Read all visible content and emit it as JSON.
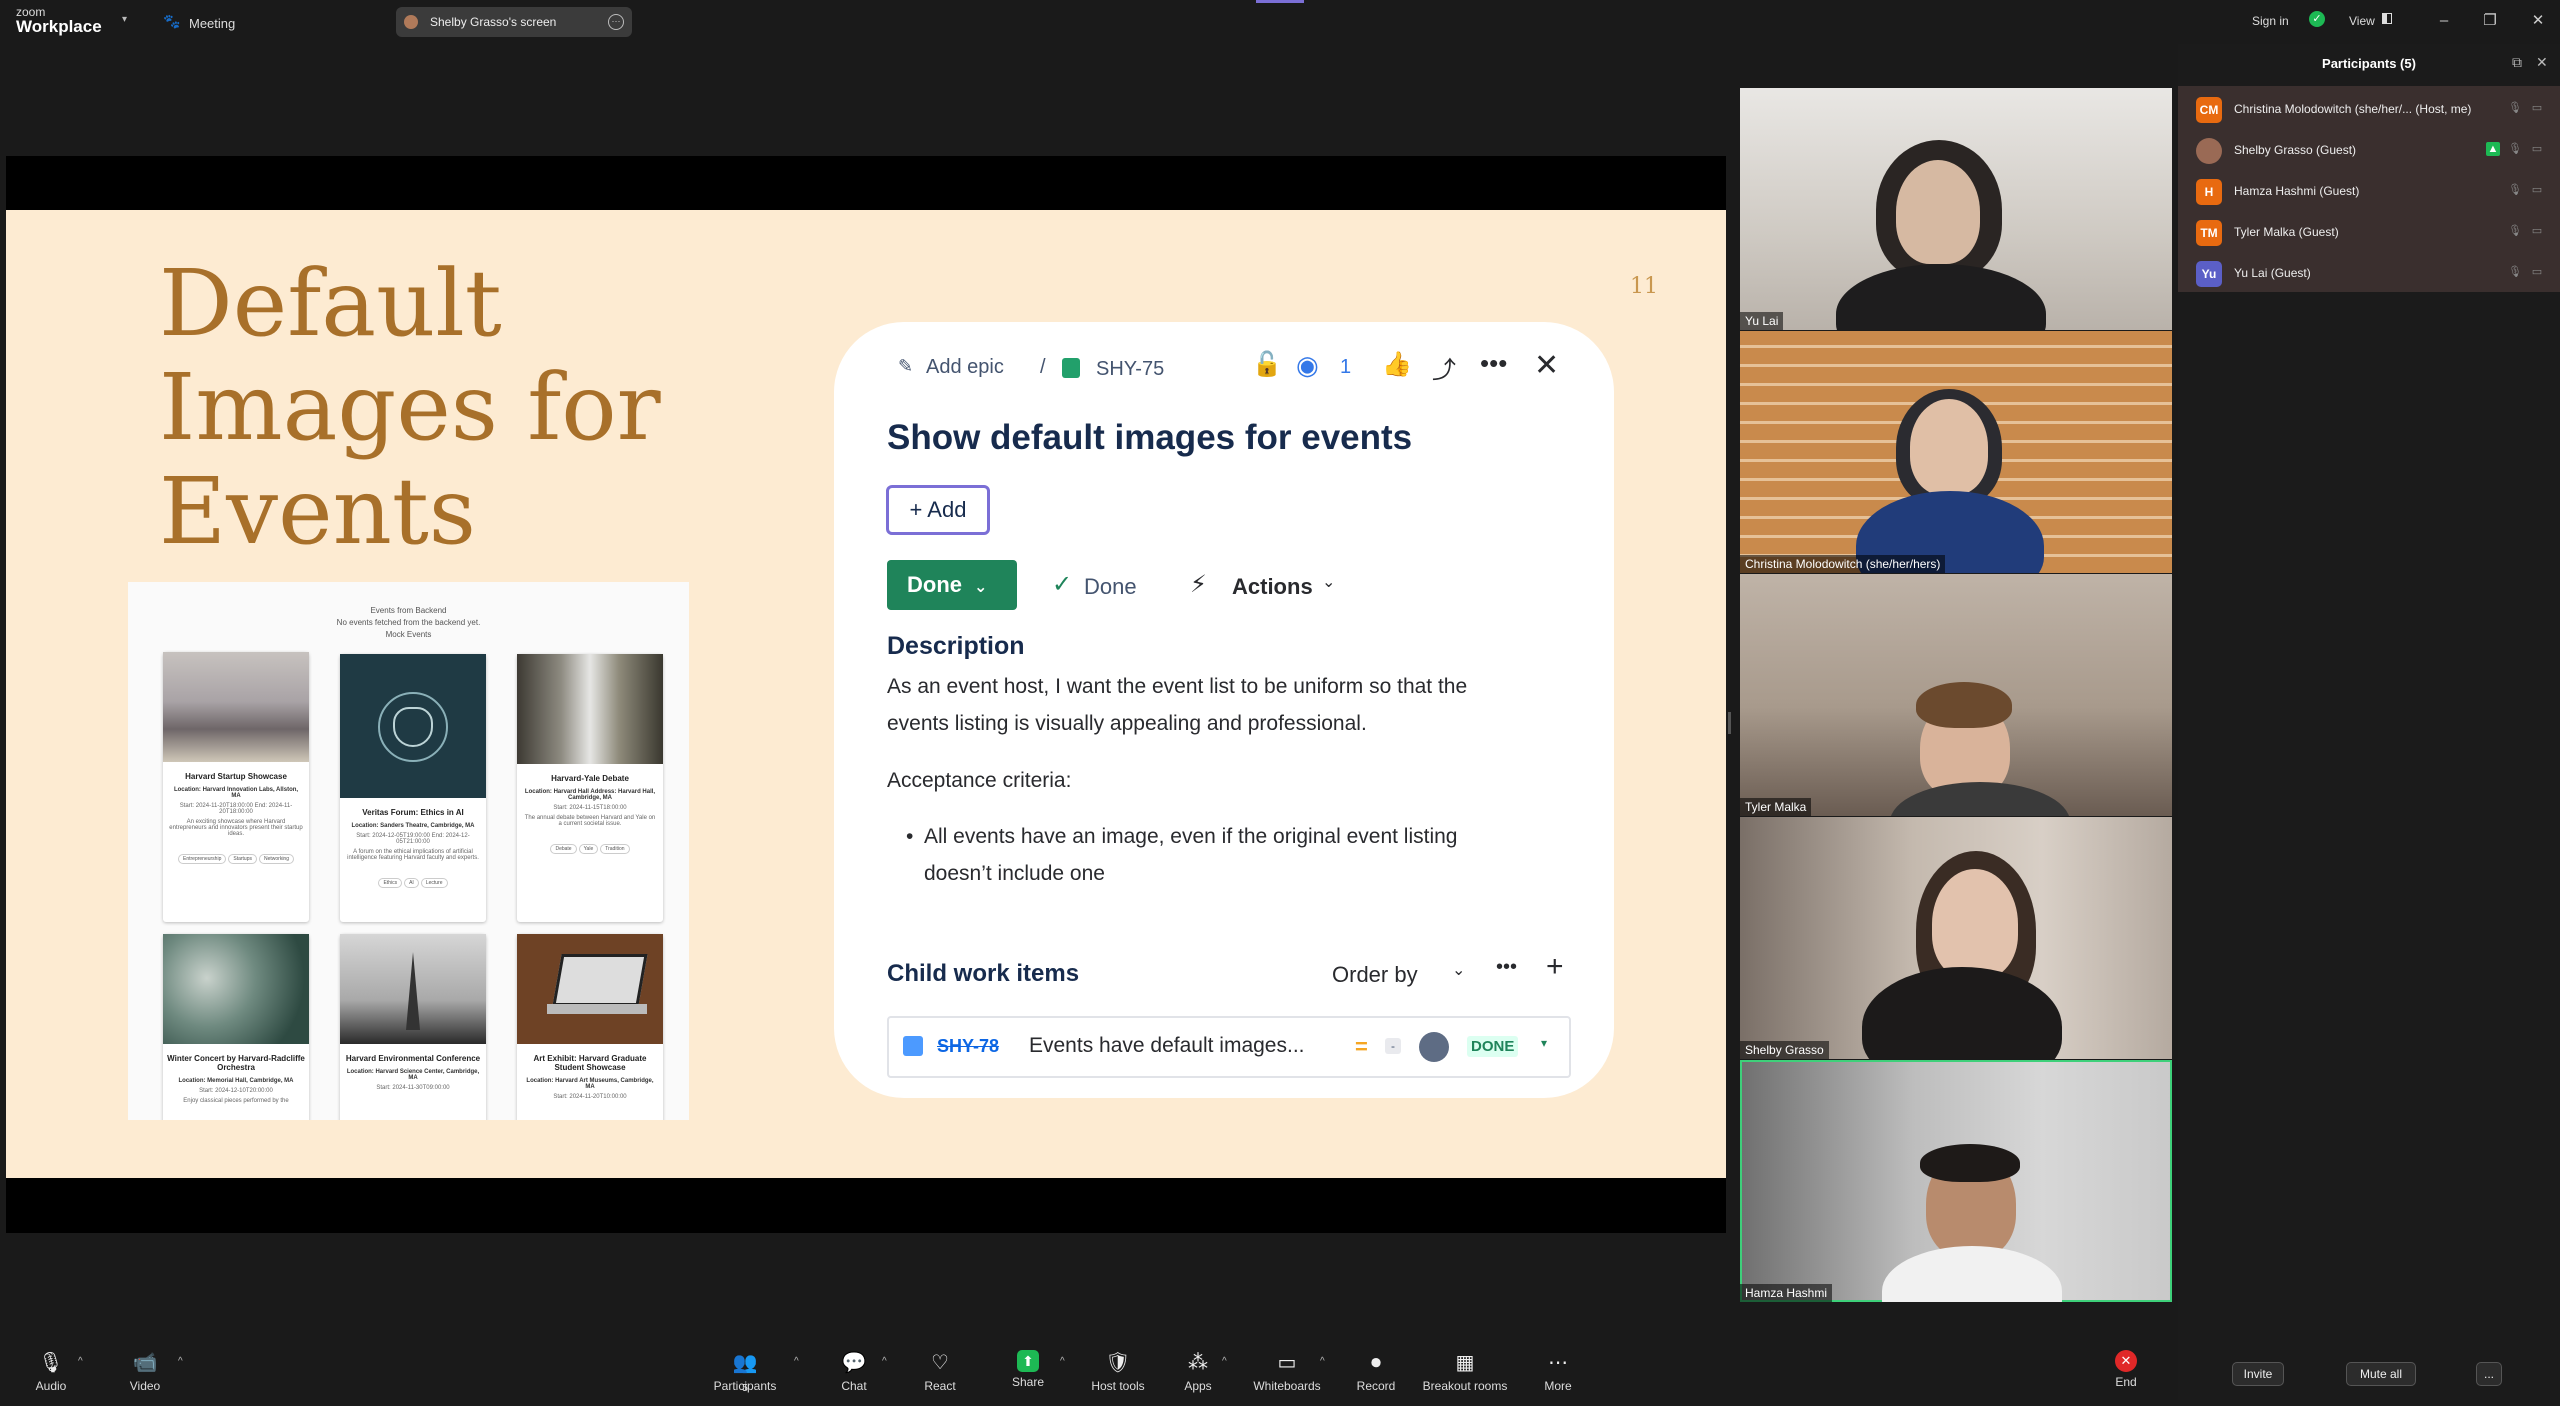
{
  "app": {
    "brand_small": "zoom",
    "brand_large": "Workplace",
    "meeting_label": "Meeting",
    "screen_pill": "Shelby Grasso's screen",
    "sign_in": "Sign in",
    "view": "View"
  },
  "slide": {
    "title": "Default\nImages for\nEvents",
    "page_number": "11",
    "mock": {
      "header_lines": [
        "Events from Backend",
        "No events fetched from the backend yet.",
        "Mock Events"
      ],
      "cards": [
        {
          "title": "Harvard Startup Showcase",
          "location": "Location: Harvard Innovation Labs, Allston, MA",
          "dates": "Start: 2024-11-20T18:00:00 End: 2024-11-20T18:00:00",
          "desc": "An exciting showcase where Harvard entrepreneurs and innovators present their startup ideas.",
          "tags": [
            "Entrepreneurship",
            "Startups",
            "Networking"
          ]
        },
        {
          "title": "Veritas Forum: Ethics in AI",
          "location": "Location: Sanders Theatre, Cambridge, MA",
          "dates": "Start: 2024-12-05T19:00:00 End: 2024-12-05T21:00:00",
          "desc": "A forum on the ethical implications of artificial intelligence featuring Harvard faculty and experts.",
          "tags": [
            "Ethics",
            "AI",
            "Lecture"
          ]
        },
        {
          "title": "Harvard-Yale Debate",
          "location": "Location: Harvard Hall Address: Harvard Hall, Cambridge, MA",
          "dates": "Start: 2024-11-15T18:00:00",
          "desc": "The annual debate between Harvard and Yale on a current societal issue.",
          "tags": [
            "Debate",
            "Yale",
            "Tradition"
          ]
        },
        {
          "title": "Winter Concert by Harvard-Radcliffe Orchestra",
          "location": "Location: Memorial Hall, Cambridge, MA",
          "dates": "Start: 2024-12-10T20:00:00",
          "desc": "Enjoy classical pieces performed by the",
          "tags": []
        },
        {
          "title": "Harvard Environmental Conference",
          "location": "Location: Harvard Science Center, Cambridge, MA",
          "dates": "Start: 2024-11-30T09:00:00",
          "desc": "",
          "tags": []
        },
        {
          "title": "Art Exhibit: Harvard Graduate Student Showcase",
          "location": "Location: Harvard Art Museums, Cambridge, MA",
          "dates": "Start: 2024-11-20T10:00:00",
          "desc": "",
          "tags": []
        }
      ]
    },
    "jira": {
      "add_epic": "Add epic",
      "issue_key": "SHY-75",
      "watchers": "1",
      "title": "Show default images for events",
      "add_button": "Add",
      "status_button": "Done",
      "resolution": "Done",
      "actions": "Actions",
      "description_heading": "Description",
      "description_line1": "As an event host, I want the event list to be uniform so that the",
      "description_line2": "events listing is visually appealing and professional.",
      "acceptance": "Acceptance criteria:",
      "bullet_line1": "All events have an image, even if the original event listing",
      "bullet_line2": "doesn’t include one",
      "child_heading": "Child work items",
      "order_by": "Order by",
      "child_key": "SHY-78",
      "child_summary": "Events have default images...",
      "child_priority": "-",
      "child_status": "DONE"
    }
  },
  "videos": [
    {
      "name": "Yu Lai"
    },
    {
      "name": "Christina Molodowitch (she/her/hers)"
    },
    {
      "name": "Tyler Malka"
    },
    {
      "name": "Shelby Grasso"
    },
    {
      "name": "Hamza Hashmi"
    }
  ],
  "participants_panel": {
    "title": "Participants (5)",
    "people": [
      {
        "initials": "CM",
        "name": "Christina Molodowitch (she/her/...  (Host, me)",
        "color": "#e86a10"
      },
      {
        "initials": "",
        "name": "Shelby Grasso (Guest)",
        "color": "#9a6a55"
      },
      {
        "initials": "H",
        "name": "Hamza Hashmi (Guest)",
        "color": "#e86a10"
      },
      {
        "initials": "TM",
        "name": "Tyler Malka (Guest)",
        "color": "#e86a10"
      },
      {
        "initials": "Yu",
        "name": "Yu Lai (Guest)",
        "color": "#5b5fc7"
      }
    ],
    "invite": "Invite",
    "mute_all": "Mute all",
    "more": "..."
  },
  "toolbar": {
    "audio": "Audio",
    "video": "Video",
    "participants": "Participants",
    "participants_count": "5",
    "chat": "Chat",
    "react": "React",
    "share": "Share",
    "host_tools": "Host tools",
    "apps": "Apps",
    "whiteboards": "Whiteboards",
    "record": "Record",
    "breakout": "Breakout rooms",
    "more": "More",
    "end": "End"
  },
  "colors": {
    "share_green": "#1db954",
    "end_red": "#e02828",
    "active_speaker_border": "#3ed07a",
    "slide_bg": "#fdebd2",
    "slide_title": "#a8702a",
    "jira_done_green": "#1f845a"
  }
}
